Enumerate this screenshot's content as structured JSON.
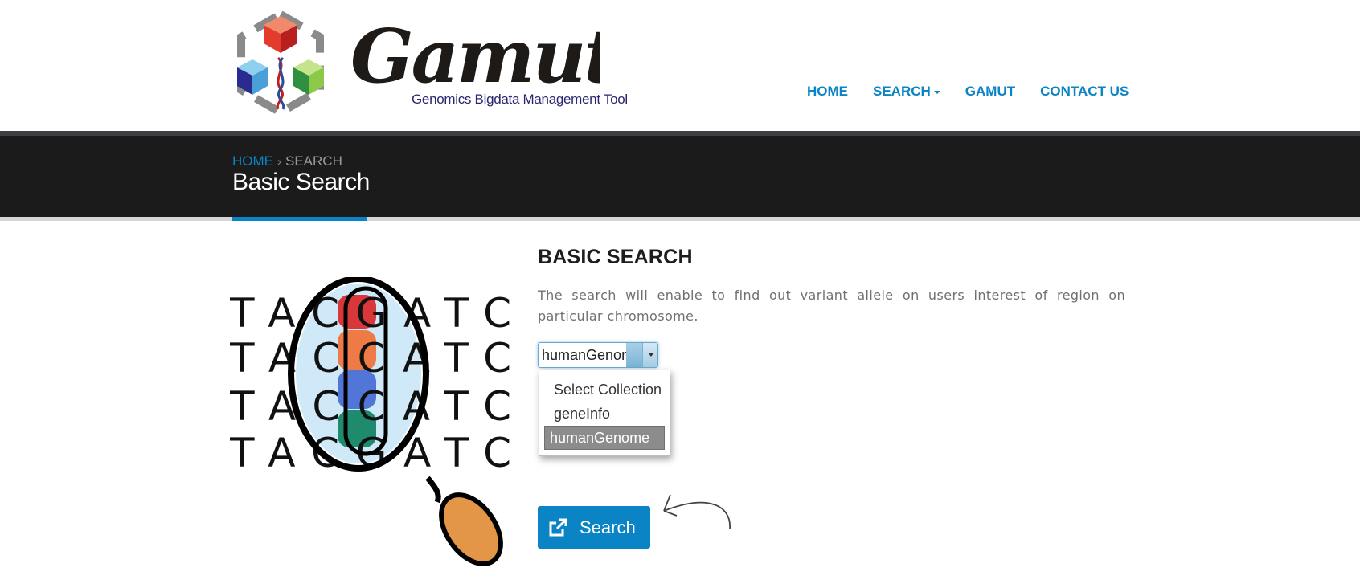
{
  "brand": {
    "name": "Gamut",
    "tagline": "Genomics Bigdata Management Tool"
  },
  "nav": {
    "items": [
      {
        "label": "HOME"
      },
      {
        "label": "SEARCH"
      },
      {
        "label": "GAMUT"
      },
      {
        "label": "CONTACT US"
      }
    ]
  },
  "breadcrumb": {
    "home": "HOME",
    "current": "SEARCH"
  },
  "page": {
    "title": "Basic Search"
  },
  "search": {
    "section_title": "BASIC SEARCH",
    "description": "The search will enable to find out variant allele on users interest of region on particular chromosome.",
    "collection_value": "humanGenome",
    "options": [
      "Select Collection",
      "geneInfo",
      "humanGenome"
    ],
    "selected_option": "humanGenome",
    "button_label": "Search"
  },
  "illustration": {
    "rows": [
      "TACGATC",
      "TACCATC",
      "TACCATC",
      "TACGATC"
    ]
  },
  "colors": {
    "accent": "#0a84c4",
    "title_bar": "#1b1b1b"
  }
}
